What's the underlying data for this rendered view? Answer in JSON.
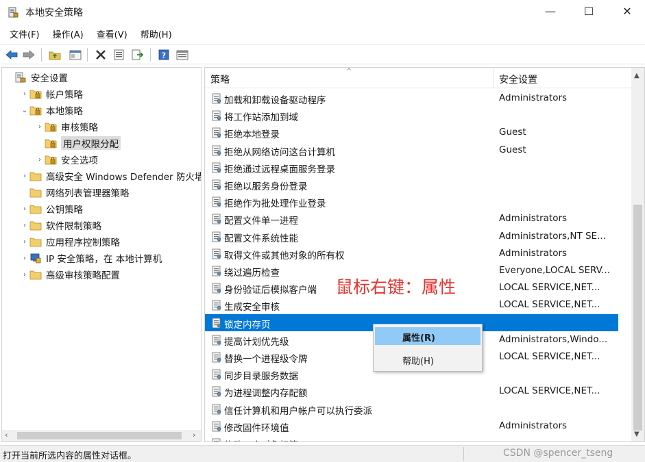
{
  "window": {
    "title": "本地安全策略",
    "min_glyph": "—",
    "max_glyph": "☐",
    "close_glyph": "✕"
  },
  "menu": [
    "文件(F)",
    "操作(A)",
    "查看(V)",
    "帮助(H)"
  ],
  "toolbar": {
    "icons": [
      "back-icon",
      "forward-icon",
      "up-folder-icon",
      "show-tree-icon",
      "delete-icon",
      "properties-icon",
      "export-icon",
      "help-icon",
      "view-icon"
    ]
  },
  "tree": {
    "items": [
      {
        "label": "安全设置",
        "expander": "",
        "icon": "security-settings-icon",
        "indent": 0,
        "selected": false
      },
      {
        "label": "帐户策略",
        "expander": "›",
        "icon": "folder-icon",
        "indent": 1,
        "selected": false
      },
      {
        "label": "本地策略",
        "expander": "⌄",
        "icon": "folder-open-icon",
        "indent": 1,
        "selected": false
      },
      {
        "label": "审核策略",
        "expander": "›",
        "icon": "folder-icon",
        "indent": 2,
        "selected": false
      },
      {
        "label": "用户权限分配",
        "expander": "",
        "icon": "folder-open-icon",
        "indent": 2,
        "selected": true
      },
      {
        "label": "安全选项",
        "expander": "›",
        "icon": "folder-icon",
        "indent": 2,
        "selected": false
      },
      {
        "label": "高级安全 Windows Defender 防火墙",
        "expander": "›",
        "icon": "folder-icon",
        "indent": 1,
        "selected": false
      },
      {
        "label": "网络列表管理器策略",
        "expander": "",
        "icon": "folder-icon",
        "indent": 1,
        "selected": false
      },
      {
        "label": "公钥策略",
        "expander": "›",
        "icon": "folder-icon",
        "indent": 1,
        "selected": false
      },
      {
        "label": "软件限制策略",
        "expander": "›",
        "icon": "folder-icon",
        "indent": 1,
        "selected": false
      },
      {
        "label": "应用程序控制策略",
        "expander": "›",
        "icon": "folder-icon",
        "indent": 1,
        "selected": false
      },
      {
        "label": "IP 安全策略，在 本地计算机",
        "expander": "›",
        "icon": "ip-security-icon",
        "indent": 1,
        "selected": false
      },
      {
        "label": "高级审核策略配置",
        "expander": "›",
        "icon": "folder-icon",
        "indent": 1,
        "selected": false
      }
    ]
  },
  "list": {
    "columns": [
      "策略",
      "安全设置"
    ],
    "rows": [
      {
        "name": "加载和卸载设备驱动程序",
        "value": "Administrators"
      },
      {
        "name": "将工作站添加到域",
        "value": ""
      },
      {
        "name": "拒绝本地登录",
        "value": "Guest"
      },
      {
        "name": "拒绝从网络访问这台计算机",
        "value": "Guest"
      },
      {
        "name": "拒绝通过远程桌面服务登录",
        "value": ""
      },
      {
        "name": "拒绝以服务身份登录",
        "value": ""
      },
      {
        "name": "拒绝作为批处理作业登录",
        "value": ""
      },
      {
        "name": "配置文件单一进程",
        "value": "Administrators"
      },
      {
        "name": "配置文件系统性能",
        "value": "Administrators,NT SE..."
      },
      {
        "name": "取得文件或其他对象的所有权",
        "value": "Administrators"
      },
      {
        "name": "绕过遍历检查",
        "value": "Everyone,LOCAL SERV..."
      },
      {
        "name": "身份验证后模拟客户端",
        "value": "LOCAL SERVICE,NET..."
      },
      {
        "name": "生成安全审核",
        "value": "LOCAL SERVICE,NET..."
      },
      {
        "name": "锁定内存页",
        "value": "",
        "selected": true
      },
      {
        "name": "提高计划优先级",
        "value": "Administrators,Windo..."
      },
      {
        "name": "替换一个进程级令牌",
        "value": "LOCAL SERVICE,NET..."
      },
      {
        "name": "同步目录服务数据",
        "value": ""
      },
      {
        "name": "为进程调整内存配额",
        "value": "LOCAL SERVICE,NET..."
      },
      {
        "name": "信任计算机和用户帐户可以执行委派",
        "value": ""
      },
      {
        "name": "修改固件环境值",
        "value": "Administrators"
      },
      {
        "name": "修改一个对象标签",
        "value": ""
      }
    ]
  },
  "context_menu": {
    "items": [
      "属性(R)",
      "帮助(H)"
    ]
  },
  "annotation": "鼠标右键：属性",
  "status": {
    "text": "打开当前所选内容的属性对话框。",
    "watermark": "CSDN @spencer_tseng"
  },
  "colors": {
    "selection": "#0078d7",
    "menu_hover": "#91c9f7",
    "annotation": "#e8322c"
  }
}
